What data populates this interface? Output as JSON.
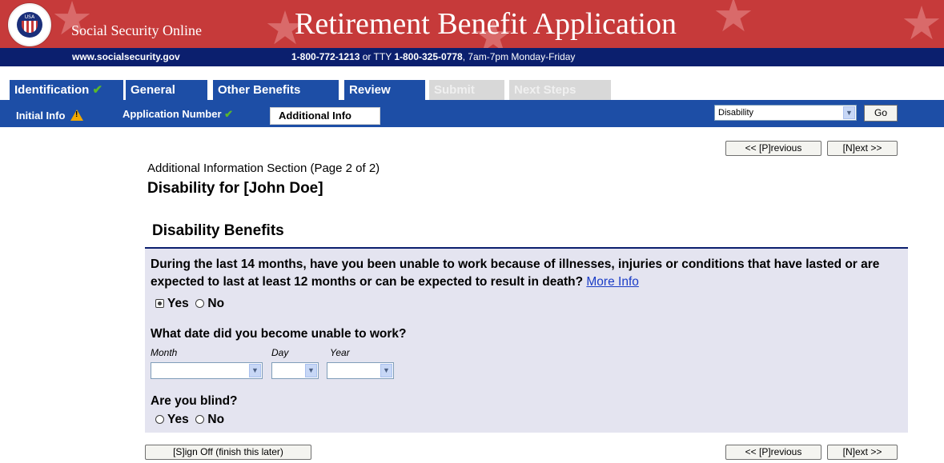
{
  "banner": {
    "site_name": "Social Security Online",
    "app_title": "Retirement Benefit Application",
    "seal_text": "SOCIAL SECURITY ADMINISTRATION",
    "seal_usa": "USA"
  },
  "infobar": {
    "url": "www.socialsecurity.gov",
    "phone": "1-800-772-1213",
    "or_tty": " or TTY ",
    "tty": "1-800-325-0778",
    "hours": ", 7am-7pm Monday-Friday"
  },
  "tabs": [
    {
      "label": "Identification",
      "state": "active",
      "check": "✔"
    },
    {
      "label": "General",
      "state": "enabled"
    },
    {
      "label": "Other Benefits",
      "state": "enabled"
    },
    {
      "label": "Review",
      "state": "enabled"
    },
    {
      "label": "Submit",
      "state": "disabled"
    },
    {
      "label": "Next Steps",
      "state": "disabled"
    }
  ],
  "subnav": {
    "initial_info": "Initial Info",
    "application_number": "Application Number",
    "check": "✔",
    "warn_mark": "!",
    "additional_info": "Additional Info",
    "section_select_value": "Disability",
    "go_label": "Go"
  },
  "nav": {
    "previous": "<< [P]revious",
    "next": "[N]ext >>",
    "sign_off": "[S]ign Off (finish this later)"
  },
  "page": {
    "section": "Additional Information Section (Page 2 of 2)",
    "title": "Disability for [John Doe]"
  },
  "form": {
    "heading": "Disability Benefits",
    "q1": "During the last 14 months, have you been unable to work because of illnesses, injuries or conditions that have lasted or are expected to last at least 12 months or can be expected to result in death?",
    "more_info": "More Info",
    "q1_yes": "Yes",
    "q1_no": "No",
    "q1_selected": "Yes",
    "q2": "What date did you become unable to work?",
    "month_label": "Month",
    "day_label": "Day",
    "year_label": "Year",
    "month_value": "",
    "day_value": "",
    "year_value": "",
    "q3": "Are you blind?",
    "q3_yes": "Yes",
    "q3_no": "No"
  },
  "colors": {
    "banner_red": "#c63a3a",
    "navy": "#0b1f6e",
    "tab_blue": "#1d4ea6",
    "panel": "#e4e4f0",
    "check_green": "#5ab82b"
  },
  "icons": {
    "check": "check-icon",
    "warning": "warning-icon",
    "dropdown": "chevron-down-icon",
    "seal": "ssa-seal-logo"
  }
}
